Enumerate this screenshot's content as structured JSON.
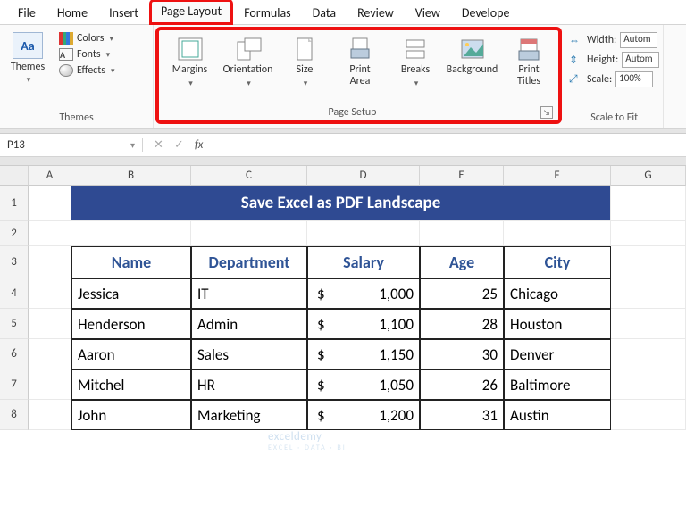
{
  "tabs": {
    "file": "File",
    "home": "Home",
    "insert": "Insert",
    "page_layout": "Page Layout",
    "formulas": "Formulas",
    "data": "Data",
    "review": "Review",
    "view": "View",
    "developer": "Develope"
  },
  "themes_group": {
    "label": "Themes",
    "themes_btn": "Themes",
    "colors": "Colors",
    "fonts": "Fonts",
    "effects": "Effects"
  },
  "page_setup": {
    "label": "Page Setup",
    "margins": "Margins",
    "orientation": "Orientation",
    "size": "Size",
    "print_area": "Print\nArea",
    "breaks": "Breaks",
    "background": "Background",
    "print_titles": "Print\nTitles"
  },
  "scale_to_fit": {
    "label": "Scale to Fit",
    "width_lbl": "Width:",
    "width_val": "Autom",
    "height_lbl": "Height:",
    "height_val": "Autom",
    "scale_lbl": "Scale:",
    "scale_val": "100%"
  },
  "name_box": "P13",
  "columns": [
    "A",
    "B",
    "C",
    "D",
    "E",
    "F",
    "G"
  ],
  "rows": [
    "1",
    "2",
    "3",
    "4",
    "5",
    "6",
    "7",
    "8"
  ],
  "title": "Save Excel as PDF Landscape",
  "headers": {
    "name": "Name",
    "dept": "Department",
    "salary": "Salary",
    "age": "Age",
    "city": "City"
  },
  "data": [
    {
      "name": "Jessica",
      "dept": "IT",
      "salary": "1,000",
      "age": "25",
      "city": "Chicago"
    },
    {
      "name": "Henderson",
      "dept": "Admin",
      "salary": "1,100",
      "age": "28",
      "city": "Houston"
    },
    {
      "name": "Aaron",
      "dept": "Sales",
      "salary": "1,150",
      "age": "30",
      "city": "Denver"
    },
    {
      "name": "Mitchel",
      "dept": "HR",
      "salary": "1,050",
      "age": "26",
      "city": "Baltimore"
    },
    {
      "name": "John",
      "dept": "Marketing",
      "salary": "1,200",
      "age": "31",
      "city": "Austin"
    }
  ],
  "currency": "$",
  "watermark": {
    "main": "exceldemy",
    "sub": "EXCEL · DATA · BI"
  }
}
